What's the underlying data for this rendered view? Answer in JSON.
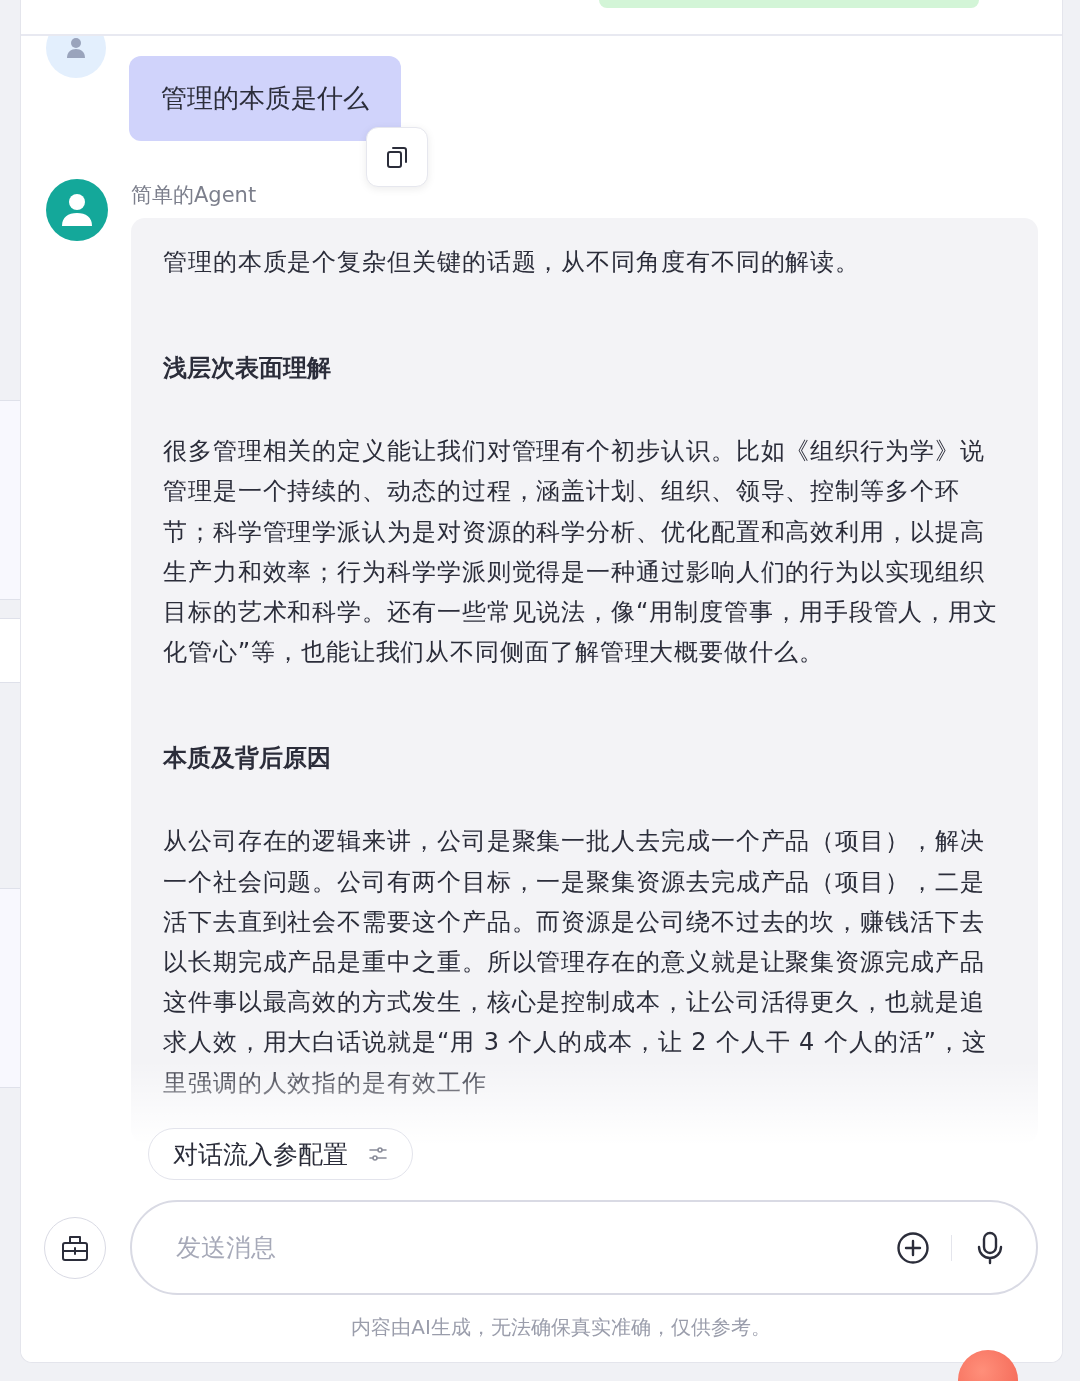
{
  "user_message": {
    "text": "管理的本质是什么"
  },
  "agent_message": {
    "name": "简单的Agent",
    "blocks": [
      {
        "kind": "paragraph",
        "text": "管理的本质是个复杂但关键的话题，从不同角度有不同的解读。"
      },
      {
        "kind": "heading",
        "text": "浅层次表面理解"
      },
      {
        "kind": "paragraph",
        "text": "很多管理相关的定义能让我们对管理有个初步认识。比如《组织行为学》说管理是一个持续的、动态的过程，涵盖计划、组织、领导、控制等多个环节；科学管理学派认为是对资源的科学分析、优化配置和高效利用，以提高生产力和效率；行为科学学派则觉得是一种通过影响人们的行为以实现组织目标的艺术和科学。还有一些常见说法，像“用制度管事，用手段管人，用文化管心”等，也能让我们从不同侧面了解管理大概要做什么。"
      },
      {
        "kind": "heading",
        "text": "本质及背后原因"
      },
      {
        "kind": "paragraph",
        "text": "从公司存在的逻辑来讲，公司是聚集一批人去完成一个产品（项目），解决一个社会问题。公司有两个目标，一是聚集资源去完成产品（项目），二是活下去直到社会不需要这个产品。而资源是公司绕不过去的坎，赚钱活下去以长期完成产品是重中之重。所以管理存在的意义就是让聚集资源完成产品这件事以最高效的方式发生，核心是控制成本，让公司活得更久，也就是追求人效，用大白话说就是“用 3 个人的成本，让 2 个人干 4 个人的活”，这里强调的人效指的是有效工作"
      }
    ]
  },
  "config_chip": {
    "label": "对话流入参配置"
  },
  "composer": {
    "placeholder": "发送消息"
  },
  "disclaimer": "内容由AI生成，无法确保真实准确，仅供参考。"
}
